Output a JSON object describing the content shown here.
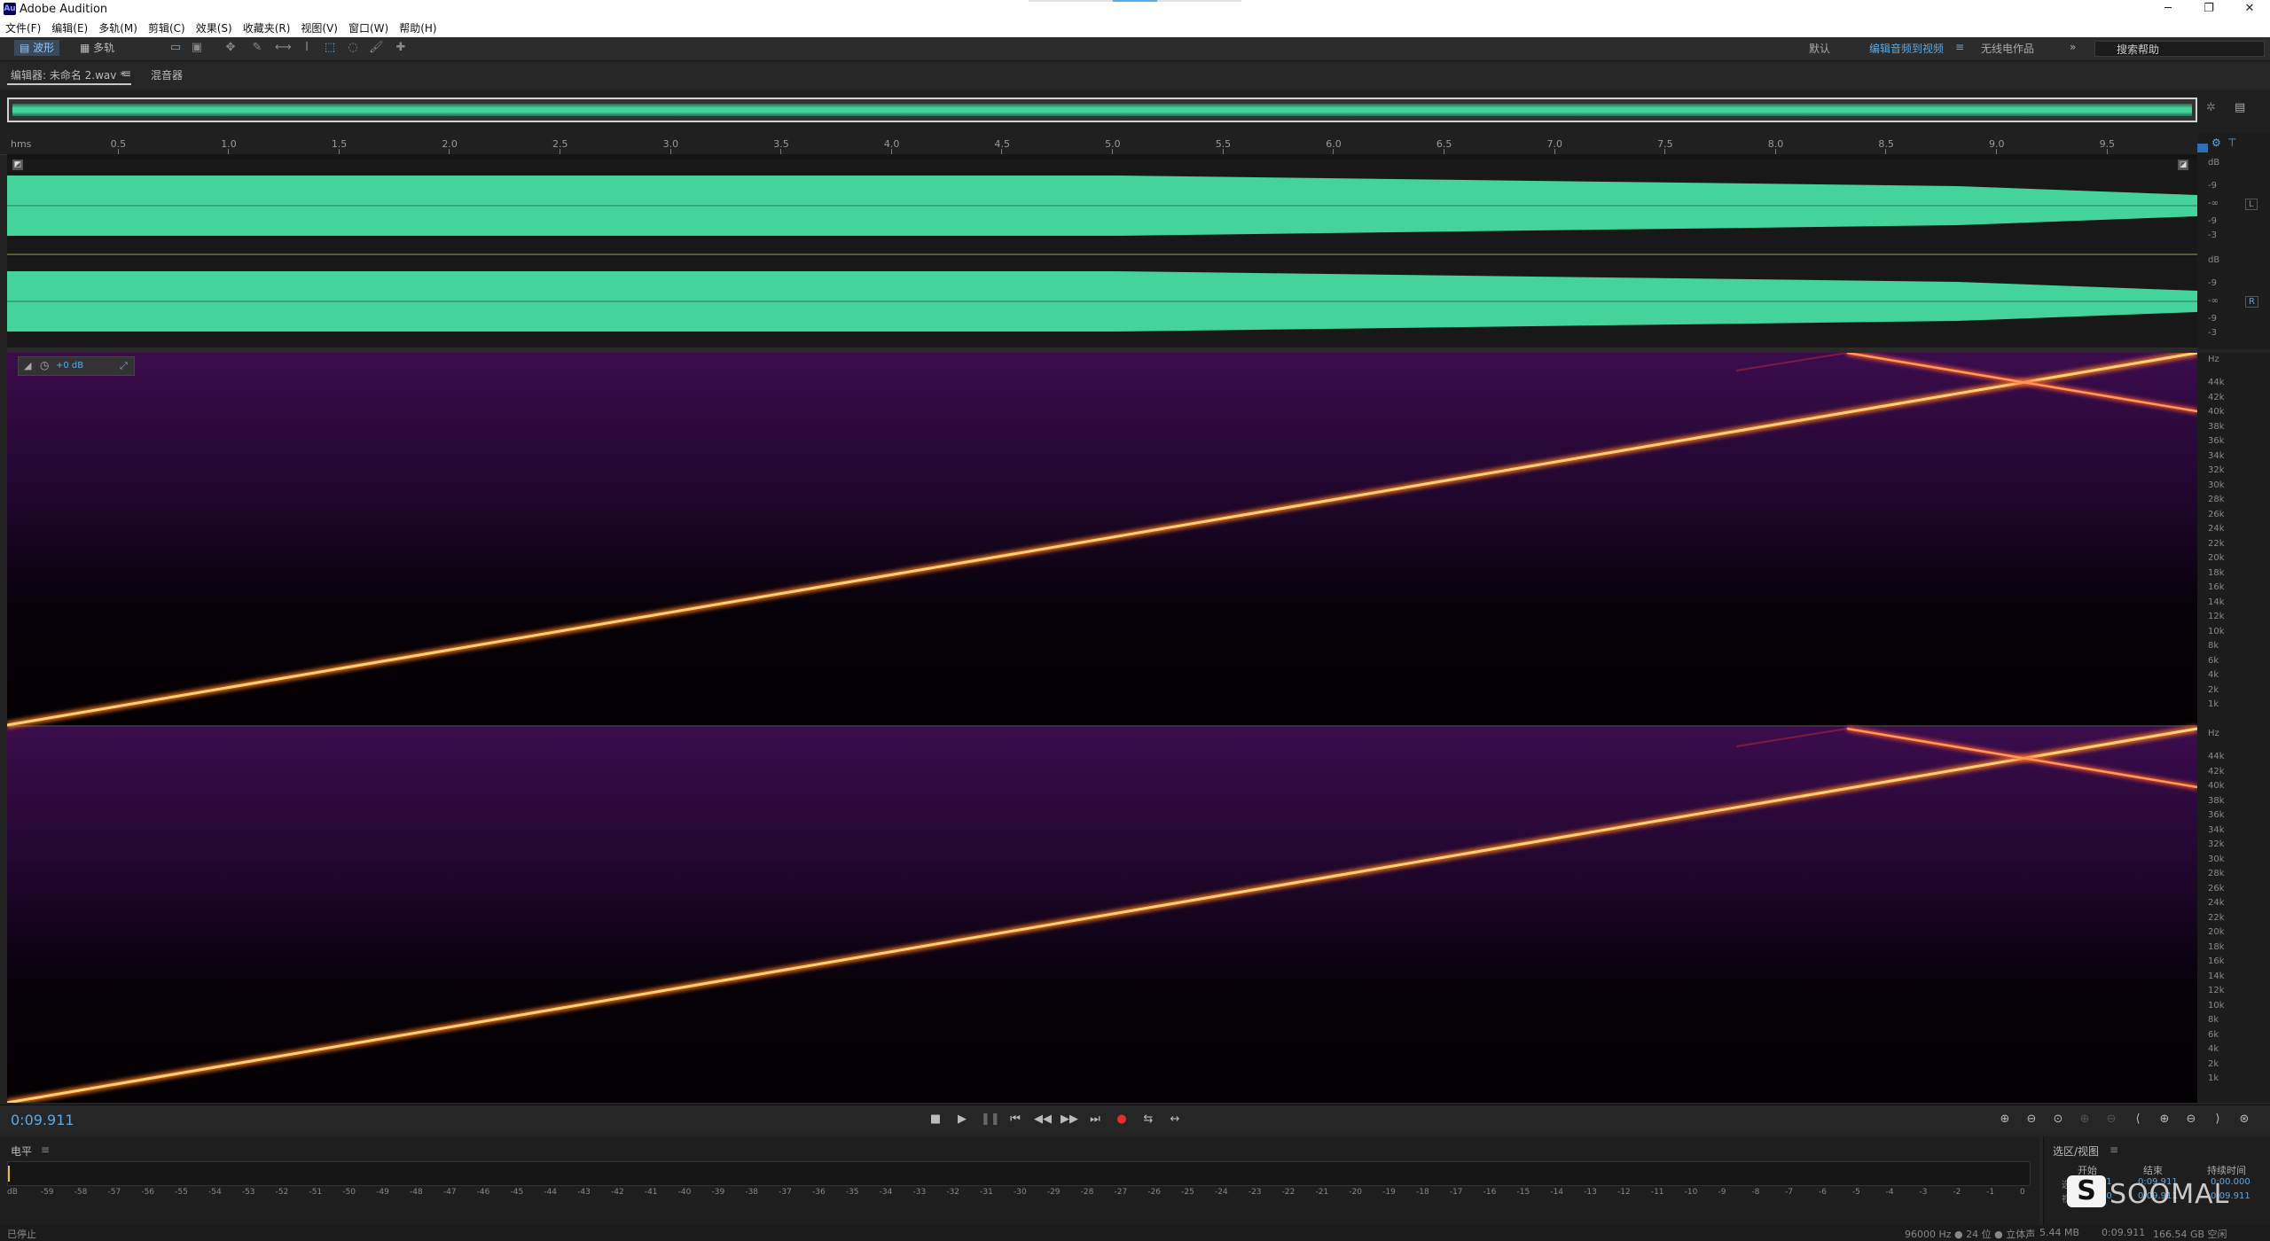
{
  "window": {
    "title": "Adobe Audition",
    "app_icon": "Au",
    "minimize": "─",
    "maximize": "❐",
    "close": "✕"
  },
  "menu": [
    "文件(F)",
    "编辑(E)",
    "多轨(M)",
    "剪辑(C)",
    "效果(S)",
    "收藏夹(R)",
    "视图(V)",
    "窗口(W)",
    "帮助(H)"
  ],
  "toolbar": {
    "waveform_label": "波形",
    "multitrack_label": "多轨",
    "workspaces": [
      "默认",
      "编辑音频到视频",
      "无线电作品"
    ],
    "active_workspace": "编辑音频到视频",
    "workspace_menu": "≡",
    "more": "»",
    "search_placeholder": "搜索帮助"
  },
  "editor": {
    "tab_label": "编辑器: 未命名 2.wav *",
    "tab_menu": "≡",
    "mixer_label": "混音器",
    "hms_label": "hms",
    "time_ticks": [
      "0.5",
      "1.0",
      "1.5",
      "2.0",
      "2.5",
      "3.0",
      "3.5",
      "4.0",
      "4.5",
      "5.0",
      "5.5",
      "6.0",
      "6.5",
      "7.0",
      "7.5",
      "8.0",
      "8.5",
      "9.0",
      "9.5"
    ],
    "amp_label": "dB",
    "amp_ticks": [
      "-9",
      "-∞",
      "-9",
      "-3"
    ],
    "channel_L": "L",
    "channel_R": "R",
    "gain_hud": "+0 dB",
    "freq_unit": "Hz",
    "freq_ticks": [
      "44k",
      "42k",
      "40k",
      "38k",
      "36k",
      "34k",
      "32k",
      "30k",
      "28k",
      "26k",
      "24k",
      "22k",
      "20k",
      "18k",
      "16k",
      "14k",
      "12k",
      "10k",
      "8k",
      "6k",
      "4k",
      "2k",
      "1k"
    ]
  },
  "transport": {
    "time": "0:09.911",
    "buttons": [
      "■",
      "▶",
      "❚❚",
      "⏮",
      "◀◀",
      "▶▶",
      "⏭",
      "●",
      "⇆",
      "↔"
    ]
  },
  "levels_panel": {
    "title": "电平",
    "menu": "≡",
    "scale": [
      "dB",
      "-59",
      "-58",
      "-57",
      "-56",
      "-55",
      "-54",
      "-53",
      "-52",
      "-51",
      "-50",
      "-49",
      "-48",
      "-47",
      "-46",
      "-45",
      "-44",
      "-43",
      "-42",
      "-41",
      "-40",
      "-39",
      "-38",
      "-37",
      "-36",
      "-35",
      "-34",
      "-33",
      "-32",
      "-31",
      "-30",
      "-29",
      "-28",
      "-27",
      "-26",
      "-25",
      "-24",
      "-23",
      "-22",
      "-21",
      "-20",
      "-19",
      "-18",
      "-17",
      "-16",
      "-15",
      "-14",
      "-13",
      "-12",
      "-11",
      "-10",
      "-9",
      "-8",
      "-7",
      "-6",
      "-5",
      "-4",
      "-3",
      "-2",
      "-1",
      "0"
    ]
  },
  "selection_view": {
    "title": "选区/视图",
    "menu": "≡",
    "col_start": "开始",
    "col_end": "结束",
    "col_duration": "持续时间",
    "row_sel": "选",
    "row_view": "视",
    "sel_start": "0:09.911",
    "sel_end": "0:09.911",
    "sel_duration": "0:00.000",
    "view_start": "0:00.000",
    "view_end": "0:09.911",
    "view_duration": "0:09.911"
  },
  "status": {
    "left": "已停止",
    "format": "96000 Hz ● 24 位 ● 立体声",
    "size": "5.44 MB",
    "duration": "0:09.911",
    "free": "166.54 GB 空闲"
  },
  "watermark": "SOOMAL",
  "colors": {
    "accent": "#5aa9e6",
    "wave": "#43d39b",
    "sweep": "#ffb347",
    "spectral_bg": "#3a0a4a"
  }
}
